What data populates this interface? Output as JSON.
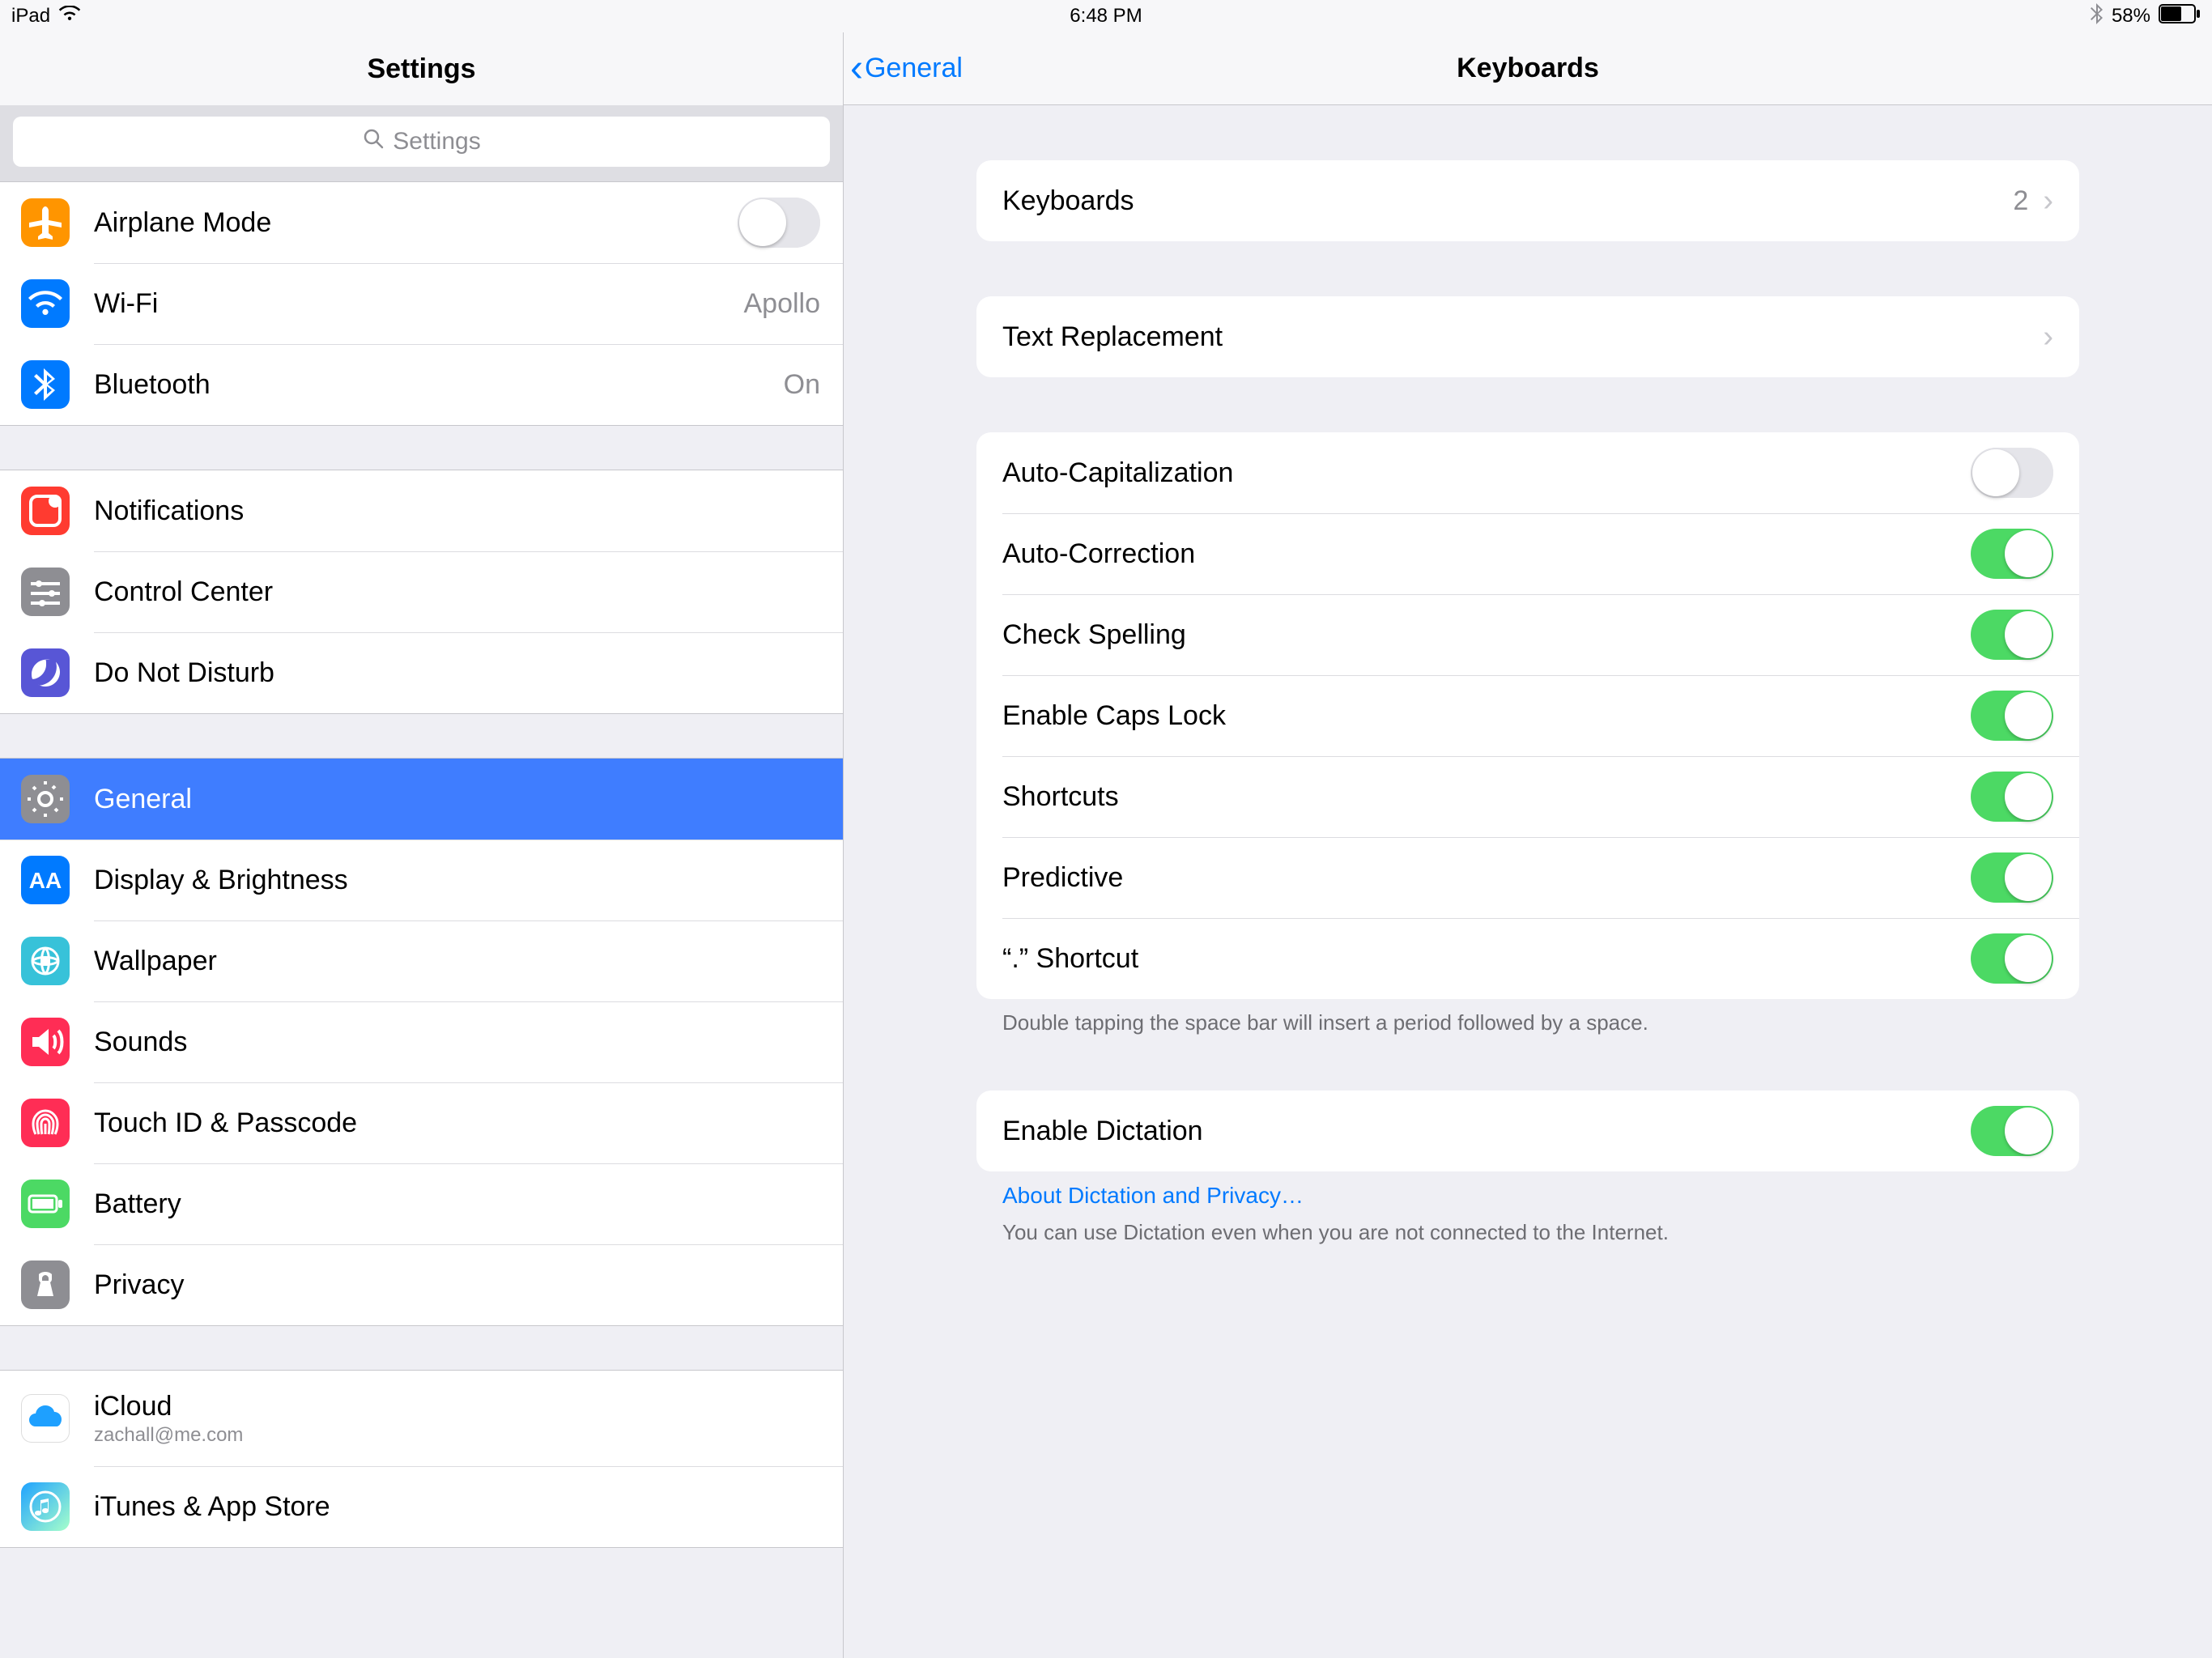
{
  "status": {
    "device": "iPad",
    "time": "6:48 PM",
    "battery": "58%"
  },
  "sidebar": {
    "title": "Settings",
    "search_placeholder": "Settings",
    "groups": [
      {
        "rows": [
          {
            "id": "airplane",
            "label": "Airplane Mode",
            "toggle": false
          },
          {
            "id": "wifi",
            "label": "Wi-Fi",
            "value": "Apollo"
          },
          {
            "id": "bluetooth",
            "label": "Bluetooth",
            "value": "On"
          }
        ]
      },
      {
        "rows": [
          {
            "id": "notifications",
            "label": "Notifications"
          },
          {
            "id": "controlcenter",
            "label": "Control Center"
          },
          {
            "id": "dnd",
            "label": "Do Not Disturb"
          }
        ]
      },
      {
        "rows": [
          {
            "id": "general",
            "label": "General",
            "selected": true
          },
          {
            "id": "display",
            "label": "Display & Brightness"
          },
          {
            "id": "wallpaper",
            "label": "Wallpaper"
          },
          {
            "id": "sounds",
            "label": "Sounds"
          },
          {
            "id": "touchid",
            "label": "Touch ID & Passcode"
          },
          {
            "id": "battery",
            "label": "Battery"
          },
          {
            "id": "privacy",
            "label": "Privacy"
          }
        ]
      },
      {
        "rows": [
          {
            "id": "icloud",
            "label": "iCloud",
            "sub": "zachall@me.com"
          },
          {
            "id": "itunes",
            "label": "iTunes & App Store"
          }
        ]
      }
    ]
  },
  "detail": {
    "back_label": "General",
    "title": "Keyboards",
    "sections": [
      {
        "rows": [
          {
            "label": "Keyboards",
            "value": "2",
            "chevron": true
          }
        ]
      },
      {
        "rows": [
          {
            "label": "Text Replacement",
            "chevron": true
          }
        ]
      },
      {
        "rows": [
          {
            "label": "Auto-Capitalization",
            "toggle": false
          },
          {
            "label": "Auto-Correction",
            "toggle": true
          },
          {
            "label": "Check Spelling",
            "toggle": true
          },
          {
            "label": "Enable Caps Lock",
            "toggle": true
          },
          {
            "label": "Shortcuts",
            "toggle": true
          },
          {
            "label": "Predictive",
            "toggle": true
          },
          {
            "label": "“.” Shortcut",
            "toggle": true
          }
        ],
        "footer": "Double tapping the space bar will insert a period followed by a space."
      },
      {
        "rows": [
          {
            "label": "Enable Dictation",
            "toggle": true
          }
        ],
        "link": "About Dictation and Privacy…",
        "footer": "You can use Dictation even when you are not connected to the Internet."
      }
    ]
  }
}
